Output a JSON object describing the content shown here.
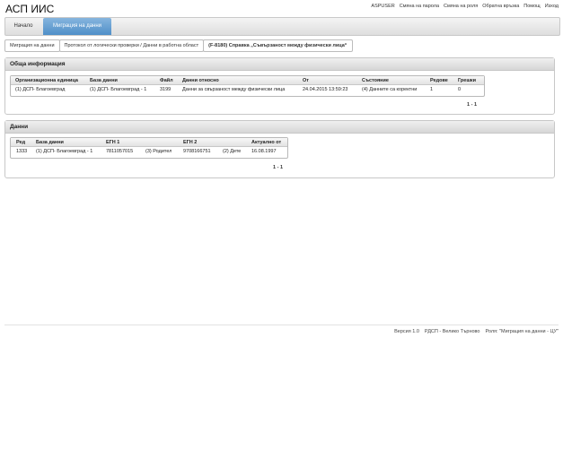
{
  "app": {
    "title": "АСП ИИС"
  },
  "top_links": [
    "ASPUSER",
    "Смяна на парола",
    "Смяна на роля",
    "Обратна връзка",
    "Помощ",
    "Изход"
  ],
  "tabs": {
    "home": "Начало",
    "active": "Миграция на данни"
  },
  "breadcrumb": [
    "Миграция на данни",
    "Протокол от логически проверки / Данни в работна област",
    "(F-8180) Справка „Съвързаност между физически лица“"
  ],
  "general": {
    "title": "Обща информация",
    "headers": [
      "Организационна единица",
      "База данни",
      "Файл",
      "Данни относно",
      "От",
      "Състояние",
      "Редове",
      "Грешки"
    ],
    "row": [
      "(1) ДСП- Благоевград",
      "(1) ДСП- Благоевград - 1",
      "3199",
      "Данни за свързаност между физически лица",
      "24.04.2015 13:59:23",
      "(4) Данните са коректни",
      "1",
      "0"
    ],
    "pager": "1 - 1"
  },
  "data": {
    "title": "Данни",
    "headers": [
      "Ред",
      "База данни",
      "ЕГН 1",
      "",
      "ЕГН 2",
      "",
      "Актуално от"
    ],
    "row": [
      "1333",
      "(1) ДСП- Благоевград - 1",
      "7811057015",
      "(3) Родител",
      "9708166751",
      "(2) Дете",
      "16.08.1997"
    ],
    "pager": "1 - 1"
  },
  "footer": [
    "Версия 1.0",
    "РДСП - Велико Търново",
    "Роля: \"Миграция на данни - ЦУ\""
  ]
}
